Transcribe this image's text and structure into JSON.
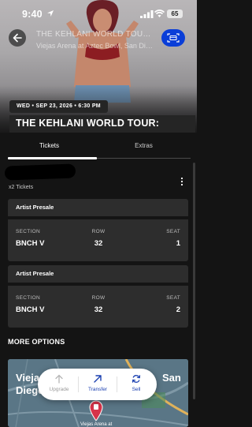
{
  "status_bar": {
    "time": "9:40",
    "battery": "65"
  },
  "header": {
    "title": "THE KEHLANI WORLD TOUR: NOR...",
    "venue": "Viejas Arena at Aztec Bowl, San Diego, S..."
  },
  "event": {
    "date_time": "WED • SEP 23, 2026 • 6:30 PM",
    "title": "THE KEHLANI WORLD TOUR:"
  },
  "tabs": [
    {
      "label": "Tickets",
      "active": true
    },
    {
      "label": "Extras",
      "active": false
    }
  ],
  "ticket_count": "x2 Tickets",
  "column_labels": {
    "section": "SECTION",
    "row": "ROW",
    "seat": "SEAT"
  },
  "tickets": [
    {
      "type": "Artist Presale",
      "section": "BNCH V",
      "row": "32",
      "seat": "1"
    },
    {
      "type": "Artist Presale",
      "section": "BNCH V",
      "row": "32",
      "seat": "2"
    }
  ],
  "more_options_label": "MORE OPTIONS",
  "map": {
    "text_left_1": "Vieja",
    "text_left_2": "Diego",
    "text_right_1": "San",
    "venue_label": "Viejas Arena at"
  },
  "actions": [
    {
      "label": "Upgrade",
      "enabled": false,
      "icon": "arrow-up-icon"
    },
    {
      "label": "Transfer",
      "enabled": true,
      "icon": "send-arrow-icon"
    },
    {
      "label": "Sell",
      "enabled": true,
      "icon": "refresh-icon"
    }
  ],
  "colors": {
    "accent_blue": "#0a3ed8",
    "action_blue": "#1a3fb0",
    "card": "#2d2d2d",
    "background": "#141414"
  }
}
